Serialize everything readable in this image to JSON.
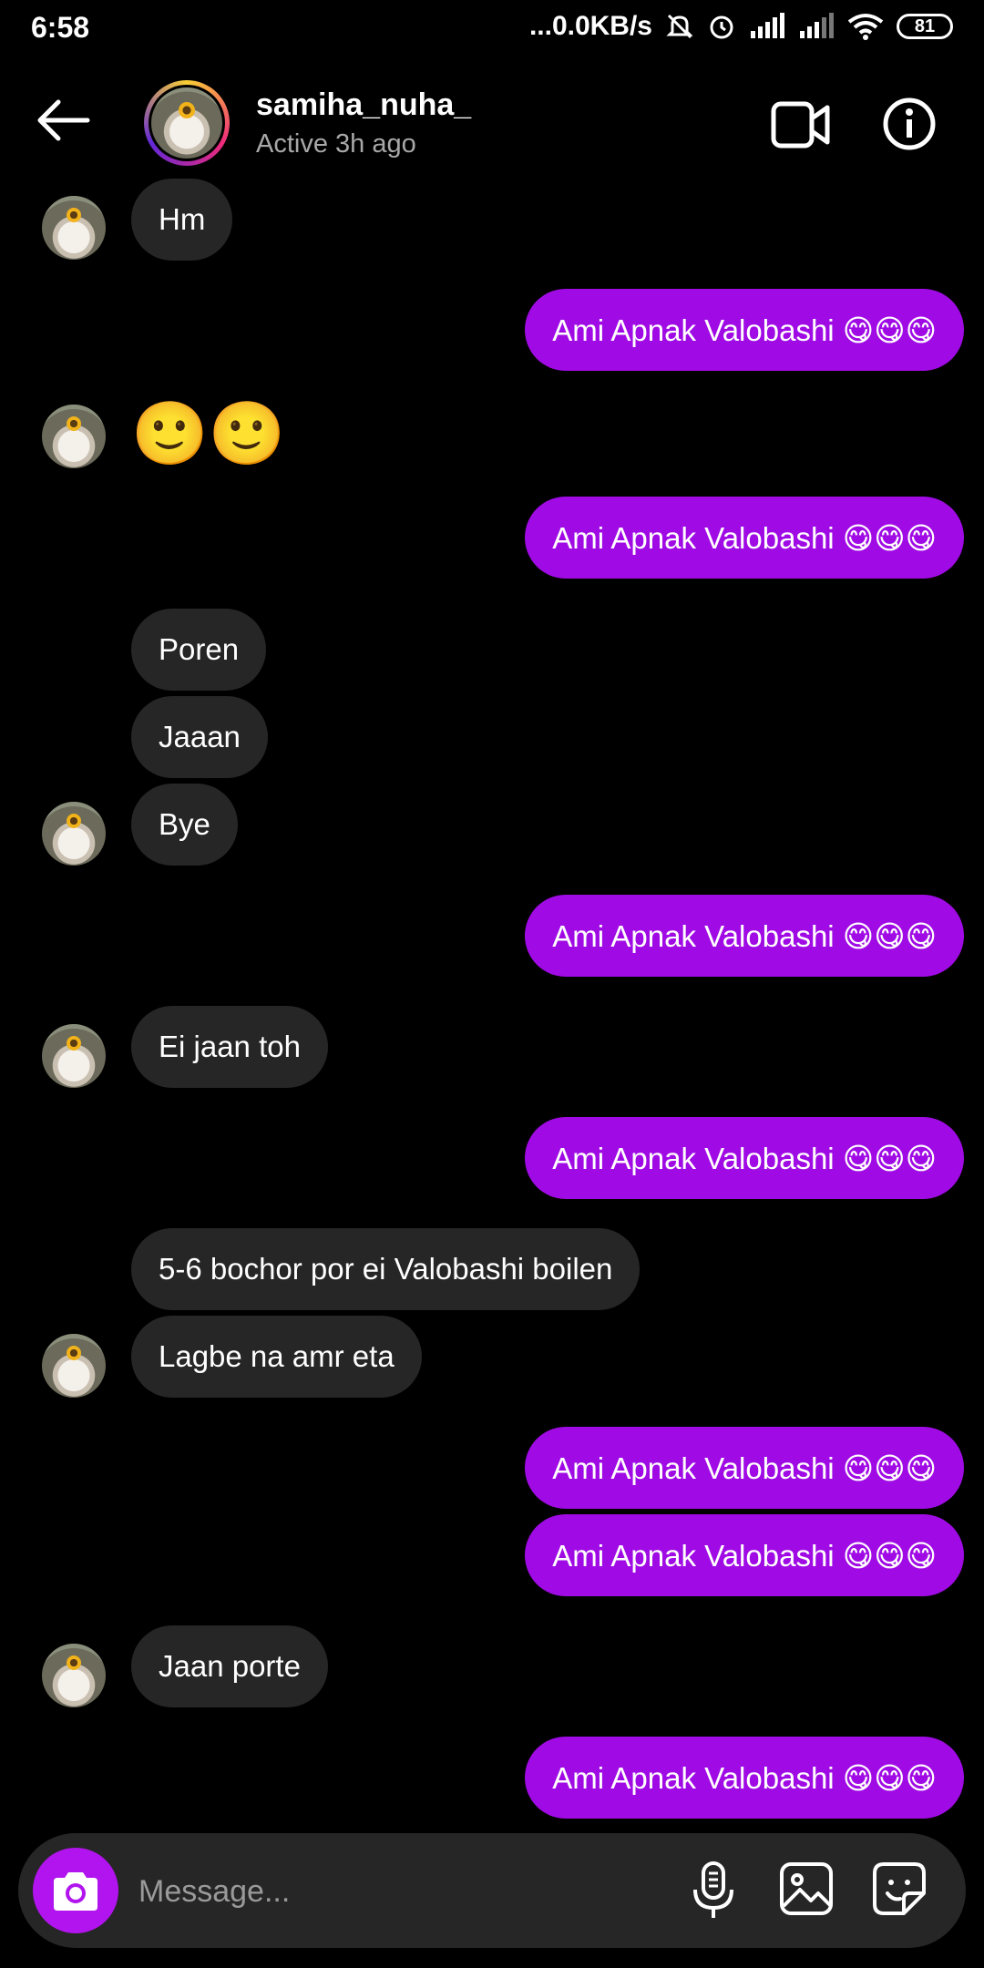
{
  "status_bar": {
    "time": "6:58",
    "network_speed": "...0.0KB/s",
    "battery": "81"
  },
  "header": {
    "username": "samiha_nuha_",
    "activity": "Active 3h ago"
  },
  "messages": [
    {
      "side": "in",
      "text": "Hm"
    },
    {
      "side": "out",
      "text": "Ami Apnak Valobashi 😋😋😋"
    },
    {
      "side": "in",
      "text": "🙂🙂",
      "emoji_only": true
    },
    {
      "side": "out",
      "text": "Ami Apnak Valobashi 😋😋😋"
    },
    {
      "side": "in",
      "text": "Poren"
    },
    {
      "side": "in",
      "text": "Jaaan"
    },
    {
      "side": "in",
      "text": "Bye"
    },
    {
      "side": "out",
      "text": "Ami Apnak Valobashi 😋😋😋"
    },
    {
      "side": "in",
      "text": "Ei jaan toh"
    },
    {
      "side": "out",
      "text": "Ami Apnak Valobashi 😋😋😋"
    },
    {
      "side": "in",
      "text": "5-6 bochor por ei Valobashi boilen"
    },
    {
      "side": "in",
      "text": "Lagbe na amr eta"
    },
    {
      "side": "out",
      "text": "Ami Apnak Valobashi 😋😋😋"
    },
    {
      "side": "out",
      "text": "Ami Apnak Valobashi 😋😋😋"
    },
    {
      "side": "in",
      "text": "Jaan porte"
    },
    {
      "side": "out",
      "text": "Ami Apnak Valobashi 😋😋😋"
    }
  ],
  "composer": {
    "placeholder": "Message..."
  },
  "icons": {
    "back": "arrow-left-icon",
    "video": "video-camera-icon",
    "info": "info-icon",
    "camera": "camera-icon",
    "mic": "microphone-icon",
    "gallery": "image-icon",
    "sticker": "sticker-icon"
  },
  "colors": {
    "outgoing_bubble": "#a00be5",
    "incoming_bubble": "#262626",
    "camera_button": "#b114ee"
  }
}
